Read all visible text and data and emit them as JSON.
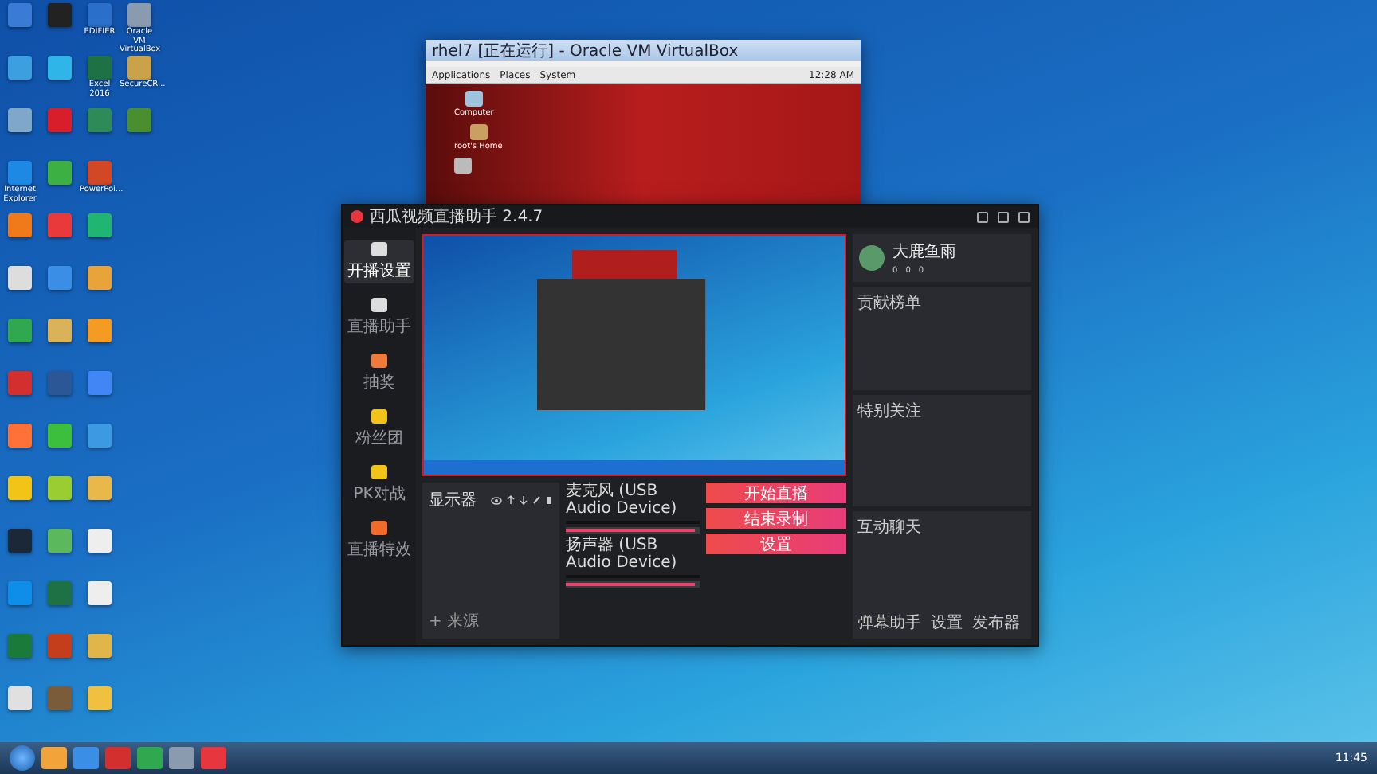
{
  "desktop": {
    "icon_rows": [
      [
        {
          "color": "#3a7bd5"
        },
        {
          "color": "#222222"
        },
        {
          "color": "#2a6fc9",
          "label": "EDIFIER"
        },
        {
          "color": "#8a9bb0",
          "label": "Oracle VM VirtualBox"
        }
      ],
      [
        {
          "color": "#3ca0e0"
        },
        {
          "color": "#2fb5e8"
        },
        {
          "color": "#1e7145",
          "label": "Excel 2016"
        },
        {
          "color": "#c9a24a",
          "label": "SecureCR..."
        }
      ],
      [
        {
          "color": "#7fa7c9"
        },
        {
          "color": "#d81e2a"
        },
        {
          "color": "#2e8b57"
        },
        {
          "color": "#4a8f2f"
        }
      ],
      [
        {
          "color": "#1e88e5",
          "label": "Internet Explorer"
        },
        {
          "color": "#3cb043"
        },
        {
          "color": "#d24726",
          "label": "PowerPoi..."
        }
      ],
      [
        {
          "color": "#f07a1a"
        },
        {
          "color": "#e83a3a"
        },
        {
          "color": "#21b574"
        }
      ],
      [
        {
          "color": "#dddddd"
        },
        {
          "color": "#3a8ee6"
        },
        {
          "color": "#e8a33a"
        }
      ],
      [
        {
          "color": "#2fa84f"
        },
        {
          "color": "#d9b25a"
        },
        {
          "color": "#f59b23"
        }
      ],
      [
        {
          "color": "#d32f2f"
        },
        {
          "color": "#2b5797"
        },
        {
          "color": "#4285f4"
        }
      ],
      [
        {
          "color": "#ff7139"
        },
        {
          "color": "#3cbf3c"
        },
        {
          "color": "#3b9ae1"
        }
      ],
      [
        {
          "color": "#f2c418"
        },
        {
          "color": "#9acd32"
        },
        {
          "color": "#e8b84a"
        }
      ],
      [
        {
          "color": "#1b2838"
        },
        {
          "color": "#5cb85c"
        },
        {
          "color": "#eeeeee"
        }
      ],
      [
        {
          "color": "#0e8ee9"
        },
        {
          "color": "#1e7145"
        },
        {
          "color": "#eeeeee"
        }
      ],
      [
        {
          "color": "#1a7a3a"
        },
        {
          "color": "#c43e1c"
        },
        {
          "color": "#e0b64a"
        }
      ],
      [
        {
          "color": "#e0e0e0"
        },
        {
          "color": "#7a5c3a"
        },
        {
          "color": "#f0c040"
        }
      ]
    ]
  },
  "vm_window": {
    "title": "rhel7 [正在运行] - Oracle VM VirtualBox",
    "menu": [
      "Applications",
      "Places",
      "System"
    ],
    "clock": "12:28 AM",
    "icons": [
      {
        "kind": "computer",
        "label": "Computer"
      },
      {
        "kind": "home",
        "label": "root's Home"
      },
      {
        "kind": "trash"
      }
    ]
  },
  "app": {
    "title": "西瓜视频直播助手 2.4.7",
    "sidebar": [
      {
        "label": "开播设置",
        "selected": true
      },
      {
        "label": "直播助手",
        "selected": false
      },
      {
        "label": "抽奖",
        "selected": false
      },
      {
        "label": "粉丝团",
        "selected": false
      },
      {
        "label": "PK对战",
        "selected": false
      },
      {
        "label": "直播特效",
        "selected": false
      }
    ],
    "sources": [
      {
        "label": "显示器",
        "visible": true
      }
    ],
    "add_source": "+ 来源",
    "audio": [
      {
        "name": "麦克风 (USB Audio Device)",
        "level": 0.97
      },
      {
        "name": "扬声器 (USB Audio Device)",
        "level": 0.97
      }
    ],
    "actions": [
      "开始直播",
      "结束录制",
      "设置"
    ],
    "profile": {
      "name": "大鹿鱼雨",
      "stats": [
        "0",
        "0",
        "0"
      ]
    },
    "panels": [
      "贡献榜单",
      "特别关注",
      "互动聊天"
    ],
    "footer": [
      "弹幕助手",
      "设置",
      "发布器"
    ]
  },
  "taskbar": {
    "clock": "11:45"
  }
}
